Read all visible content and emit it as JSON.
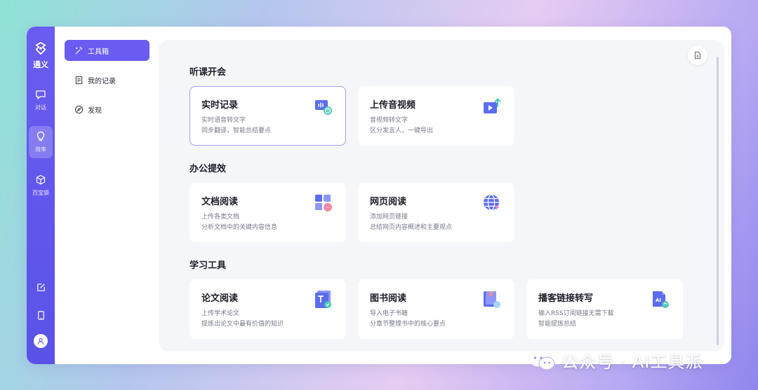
{
  "rail": {
    "logo_text": "通义",
    "items": [
      {
        "label": "对话",
        "icon": "chat-icon"
      },
      {
        "label": "效率",
        "icon": "lightbulb-icon",
        "active": true
      },
      {
        "label": "百宝袋",
        "icon": "cube-icon"
      }
    ],
    "bottom_icons": [
      "edit-icon",
      "tablet-icon",
      "user-icon"
    ]
  },
  "nav": {
    "items": [
      {
        "label": "工具箱",
        "icon": "magic-wand-icon",
        "active": true
      },
      {
        "label": "我的记录",
        "icon": "notes-icon"
      },
      {
        "label": "发现",
        "icon": "compass-icon"
      }
    ]
  },
  "sections": [
    {
      "title": "听课开会",
      "cards": [
        {
          "title": "实时记录",
          "desc1": "实时语音转文字",
          "desc2": "同步翻译，智能总结要点",
          "icon": "realtime-record-icon",
          "selected": true
        },
        {
          "title": "上传音视频",
          "desc1": "音视频转文字",
          "desc2": "区分发言人，一键导出",
          "icon": "upload-video-icon"
        }
      ]
    },
    {
      "title": "办公提效",
      "cards": [
        {
          "title": "文档阅读",
          "desc1": "上传各类文档",
          "desc2": "分析文档中的关键内容信息",
          "icon": "document-read-icon"
        },
        {
          "title": "网页阅读",
          "desc1": "添加网页链接",
          "desc2": "总结网页内容概述和主要观点",
          "icon": "web-globe-icon"
        }
      ]
    },
    {
      "title": "学习工具",
      "cards": [
        {
          "title": "论文阅读",
          "desc1": "上传学术论文",
          "desc2": "提炼出论文中最有价值的知识",
          "icon": "paper-read-icon"
        },
        {
          "title": "图书阅读",
          "desc1": "导入电子书籍",
          "desc2": "分章节整理书中的核心要点",
          "icon": "book-read-icon"
        },
        {
          "title": "播客链接转写",
          "desc1": "输入RSS订阅链接无需下载",
          "desc2": "智能提炼总结",
          "icon": "podcast-ai-icon"
        }
      ]
    }
  ],
  "watermark": {
    "text": "公众号 · AI工具派",
    "icon": "wechat-icon"
  },
  "colors": {
    "accent": "#6a5cf0",
    "rail": "#5a52e8",
    "main_bg": "#f5f6fa"
  }
}
